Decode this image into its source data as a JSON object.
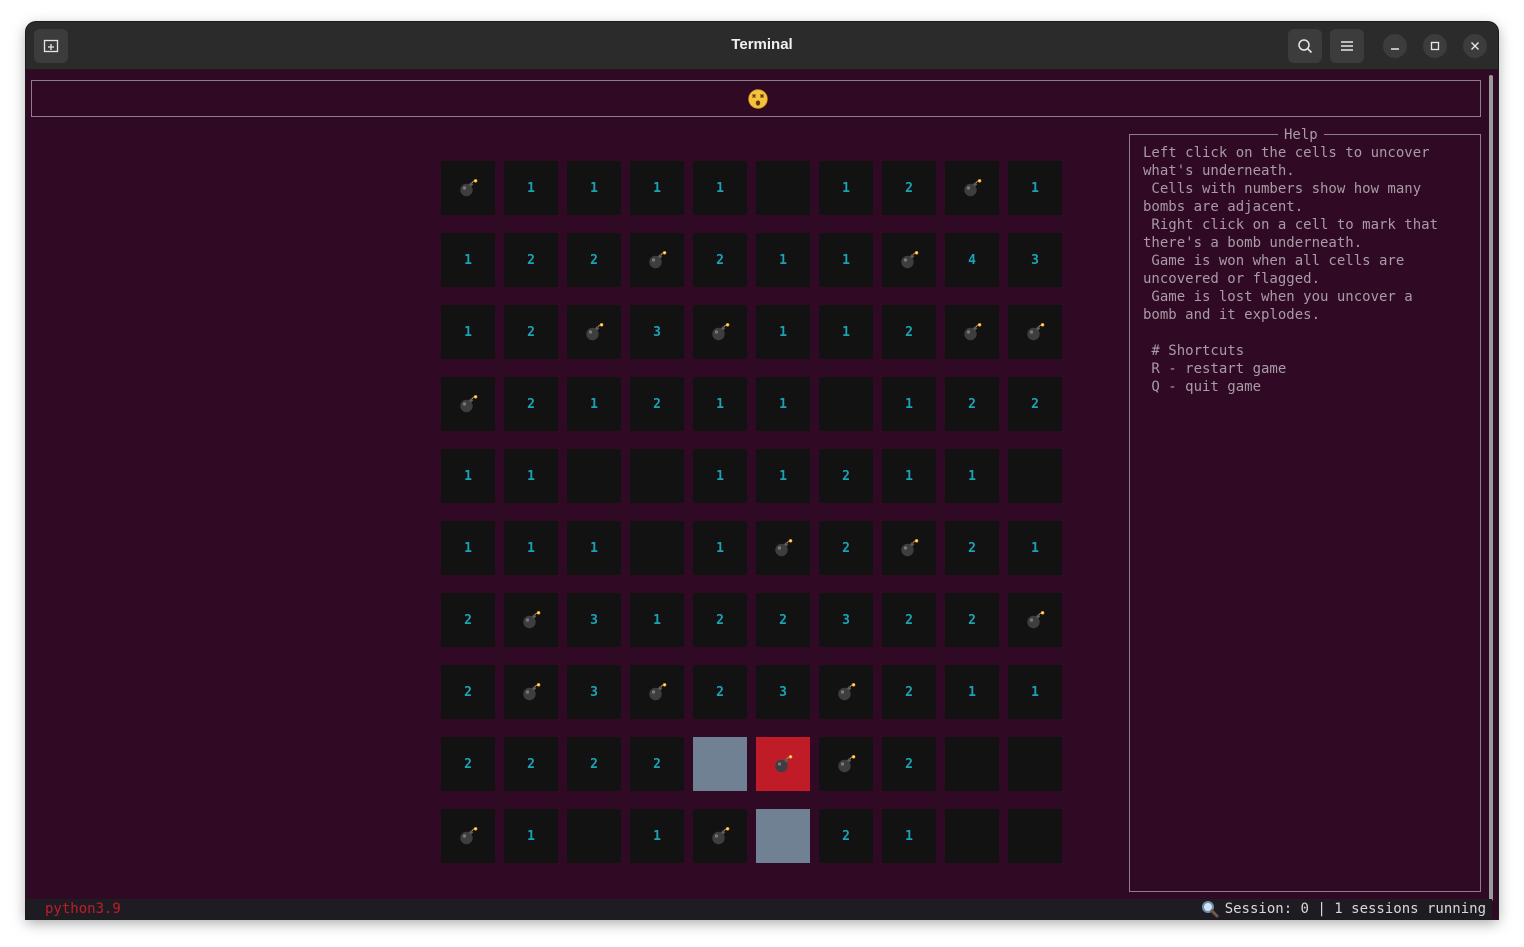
{
  "window": {
    "title": "Terminal"
  },
  "game": {
    "status_icon": "dizzy-face-icon",
    "rows": [
      [
        "bomb",
        "1",
        "1",
        "1",
        "1",
        "",
        "1",
        "2",
        "bomb",
        "1"
      ],
      [
        "1",
        "2",
        "2",
        "bomb",
        "2",
        "1",
        "1",
        "bomb",
        "4",
        "3"
      ],
      [
        "1",
        "2",
        "bomb",
        "3",
        "bomb",
        "1",
        "1",
        "2",
        "bomb",
        "bomb"
      ],
      [
        "bomb",
        "2",
        "1",
        "2",
        "1",
        "1",
        "",
        "1",
        "2",
        "2"
      ],
      [
        "1",
        "1",
        "",
        "",
        "1",
        "1",
        "2",
        "1",
        "1",
        ""
      ],
      [
        "1",
        "1",
        "1",
        "",
        "1",
        "bomb",
        "2",
        "bomb",
        "2",
        "1"
      ],
      [
        "2",
        "bomb",
        "3",
        "1",
        "2",
        "2",
        "3",
        "2",
        "2",
        "bomb"
      ],
      [
        "2",
        "bomb",
        "3",
        "bomb",
        "2",
        "3",
        "bomb",
        "2",
        "1",
        "1"
      ],
      [
        "2",
        "2",
        "2",
        "2",
        "revealed",
        "exploded",
        "bomb",
        "2",
        "",
        ""
      ],
      [
        "bomb",
        "1",
        "",
        "1",
        "bomb",
        "revealed",
        "2",
        "1",
        "",
        ""
      ]
    ],
    "colors": {
      "number": "#1ba3b5",
      "cell": "#121212",
      "revealed": "#6f8192",
      "exploded": "#c01c28",
      "background": "#300a24"
    }
  },
  "help": {
    "title": "Help",
    "lines": [
      "Left click on the cells to uncover",
      "what's underneath.",
      " Cells with numbers show how many",
      "bombs are adjacent.",
      " Right click on a cell to mark that",
      "there's a bomb underneath.",
      " Game is won when all cells are",
      "uncovered or flagged.",
      " Game is lost when you uncover a",
      "bomb and it explodes.",
      "",
      " # Shortcuts",
      " R - restart game",
      " Q - quit game"
    ]
  },
  "statusbar": {
    "process": "python3.9",
    "session": "Session: 0 | 1 sessions running"
  }
}
